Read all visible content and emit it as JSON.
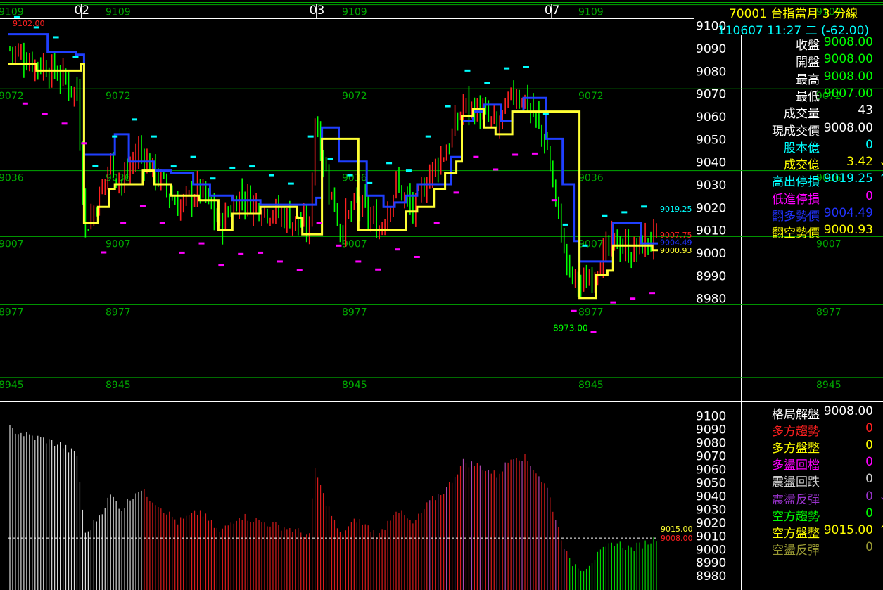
{
  "header": {
    "title": "70001  台指當月 3 分線",
    "subtitle": "110607 11:27 二   (-62.00)"
  },
  "quote_rows": [
    {
      "label": "收盤",
      "value": "9008.00",
      "label_color": "#ffffff",
      "value_color": "#00ff00",
      "arrow": ""
    },
    {
      "label": "開盤",
      "value": "9008.00",
      "label_color": "#ffffff",
      "value_color": "#00ff00",
      "arrow": ""
    },
    {
      "label": "最高",
      "value": "9008.00",
      "label_color": "#ffffff",
      "value_color": "#00ff00",
      "arrow": ""
    },
    {
      "label": "最低",
      "value": "9007.00",
      "label_color": "#ffffff",
      "value_color": "#00ff00",
      "arrow": ""
    },
    {
      "label": "成交量",
      "value": "43",
      "label_color": "#ffffff",
      "value_color": "#ffffff",
      "arrow": ""
    },
    {
      "label": "現成交價",
      "value": "9008.00",
      "label_color": "#ffffff",
      "value_color": "#ffffff",
      "arrow": ""
    },
    {
      "label": "股本億",
      "value": "0",
      "label_color": "#00ffff",
      "value_color": "#00ffff",
      "arrow": ""
    },
    {
      "label": "成交億",
      "value": "3.42",
      "label_color": "#ffff00",
      "value_color": "#ffff00",
      "arrow": "↓"
    },
    {
      "label": "高出停損",
      "value": "9019.25",
      "label_color": "#00ffff",
      "value_color": "#00ffff",
      "arrow": "↑"
    },
    {
      "label": "低進停損",
      "value": "0",
      "label_color": "#ff00ff",
      "value_color": "#ff00ff",
      "arrow": ""
    },
    {
      "label": "翻多勢價",
      "value": "9004.49",
      "label_color": "#2233ff",
      "value_color": "#2233ff",
      "arrow": ""
    },
    {
      "label": "翻空勢價",
      "value": "9000.93",
      "label_color": "#ffff00",
      "value_color": "#ffff00",
      "arrow": ""
    }
  ],
  "pattern_rows": [
    {
      "label": "格局解盤",
      "value": "9008.00",
      "label_color": "#ffffff",
      "value_color": "#ffffff",
      "arrow": ""
    },
    {
      "label": "多方趨勢",
      "value": "0",
      "label_color": "#ff2020",
      "value_color": "#ff2020",
      "arrow": ""
    },
    {
      "label": "多方盤整",
      "value": "0",
      "label_color": "#ffff00",
      "value_color": "#ffff00",
      "arrow": ""
    },
    {
      "label": "多盪回檔",
      "value": "0",
      "label_color": "#ff00ff",
      "value_color": "#ff00ff",
      "arrow": ""
    },
    {
      "label": "震盪回跌",
      "value": "0",
      "label_color": "#d0d0d0",
      "value_color": "#d0d0d0",
      "arrow": ""
    },
    {
      "label": "震盪反彈",
      "value": "0",
      "label_color": "#9933cc",
      "value_color": "#9933cc",
      "arrow": "↓"
    },
    {
      "label": "空方趨勢",
      "value": "0",
      "label_color": "#00ff00",
      "value_color": "#00ff00",
      "arrow": ""
    },
    {
      "label": "空方盤整",
      "value": "9015.00",
      "label_color": "#ffff00",
      "value_color": "#ffff00",
      "arrow": "↑"
    },
    {
      "label": "空盪反彈",
      "value": "0",
      "label_color": "#999933",
      "value_color": "#999933",
      "arrow": ""
    }
  ],
  "colors": {
    "up": "#ff2020",
    "down": "#00ff00",
    "grid": "#00aa00",
    "blue_line": "#1f3fff",
    "yellow_line": "#ffff33",
    "cyan_mark": "#00ffff",
    "magenta_mark": "#ff00ff"
  },
  "chart_data": [
    {
      "type": "candlestick",
      "x_tick_labels": [
        "02",
        "03",
        "07"
      ],
      "x_tick_bar_index": [
        26,
        110,
        194
      ],
      "bar_count": 232,
      "y_range": [
        8940,
        9103
      ],
      "y_tick_labels": [
        9100,
        9090,
        9080,
        9070,
        9060,
        9050,
        9040,
        9030,
        9020,
        9010,
        9000,
        8990,
        8980
      ],
      "level_lines": [
        9109,
        9072,
        9036,
        9007,
        8977,
        8945
      ],
      "annotations": [
        {
          "text": "9102.00",
          "value": 9102
        },
        {
          "text": "8973.00",
          "value": 8973
        },
        {
          "text": "9019.25",
          "value": 9019.25
        },
        {
          "text": "9007.75",
          "value": 9007.75
        },
        {
          "text": "9004.49",
          "value": 9004.49
        },
        {
          "text": "9000.93",
          "value": 9000.93
        }
      ],
      "close_path": [
        [
          0,
          9090
        ],
        [
          6,
          9085
        ],
        [
          12,
          9082
        ],
        [
          18,
          9078
        ],
        [
          24,
          9070
        ],
        [
          27,
          9010
        ],
        [
          32,
          9025
        ],
        [
          36,
          9040
        ],
        [
          40,
          9030
        ],
        [
          46,
          9045
        ],
        [
          52,
          9035
        ],
        [
          60,
          9020
        ],
        [
          68,
          9028
        ],
        [
          75,
          9012
        ],
        [
          82,
          9025
        ],
        [
          90,
          9020
        ],
        [
          100,
          9015
        ],
        [
          107,
          9010
        ],
        [
          109,
          9060
        ],
        [
          112,
          9040
        ],
        [
          118,
          9010
        ],
        [
          124,
          9022
        ],
        [
          132,
          9010
        ],
        [
          138,
          9030
        ],
        [
          144,
          9018
        ],
        [
          150,
          9035
        ],
        [
          156,
          9045
        ],
        [
          162,
          9065
        ],
        [
          168,
          9062
        ],
        [
          174,
          9055
        ],
        [
          180,
          9070
        ],
        [
          184,
          9068
        ],
        [
          188,
          9058
        ],
        [
          192,
          9045
        ],
        [
          196,
          9015
        ],
        [
          200,
          8990
        ],
        [
          205,
          8985
        ],
        [
          210,
          8995
        ],
        [
          216,
          9005
        ],
        [
          222,
          9000
        ],
        [
          228,
          9005
        ],
        [
          231,
          9008
        ]
      ],
      "blue_stop_path": [
        [
          0,
          9096
        ],
        [
          10,
          9096
        ],
        [
          14,
          9088
        ],
        [
          24,
          9087
        ],
        [
          27,
          9043
        ],
        [
          36,
          9043
        ],
        [
          38,
          9052
        ],
        [
          42,
          9052
        ],
        [
          43,
          9040
        ],
        [
          50,
          9040
        ],
        [
          52,
          9036
        ],
        [
          58,
          9035
        ],
        [
          66,
          9030
        ],
        [
          72,
          9025
        ],
        [
          80,
          9023
        ],
        [
          90,
          9021
        ],
        [
          105,
          9021
        ],
        [
          110,
          9024
        ],
        [
          112,
          9055
        ],
        [
          117,
          9055
        ],
        [
          118,
          9040
        ],
        [
          124,
          9040
        ],
        [
          128,
          9025
        ],
        [
          134,
          9020
        ],
        [
          138,
          9022
        ],
        [
          142,
          9025
        ],
        [
          146,
          9030
        ],
        [
          150,
          9030
        ],
        [
          154,
          9030
        ],
        [
          158,
          9042
        ],
        [
          162,
          9058
        ],
        [
          166,
          9062
        ],
        [
          170,
          9065
        ],
        [
          176,
          9058
        ],
        [
          180,
          9062
        ],
        [
          184,
          9068
        ],
        [
          188,
          9068
        ],
        [
          192,
          9050
        ],
        [
          198,
          9030
        ],
        [
          202,
          9005
        ],
        [
          204,
          8996
        ],
        [
          214,
          8996
        ],
        [
          216,
          9013
        ],
        [
          224,
          9013
        ],
        [
          226,
          9004
        ],
        [
          231,
          9004
        ]
      ],
      "yellow_stop_path": [
        [
          0,
          9083
        ],
        [
          10,
          9080
        ],
        [
          20,
          9080
        ],
        [
          26,
          9083
        ],
        [
          27,
          9013
        ],
        [
          32,
          9020
        ],
        [
          36,
          9028
        ],
        [
          38,
          9030
        ],
        [
          48,
          9036
        ],
        [
          52,
          9030
        ],
        [
          58,
          9025
        ],
        [
          68,
          9023
        ],
        [
          75,
          9010
        ],
        [
          80,
          9017
        ],
        [
          90,
          9020
        ],
        [
          103,
          9015
        ],
        [
          105,
          9008
        ],
        [
          110,
          9008
        ],
        [
          112,
          9050
        ],
        [
          124,
          9050
        ],
        [
          125,
          9010
        ],
        [
          142,
          9018
        ],
        [
          146,
          9020
        ],
        [
          150,
          9020
        ],
        [
          152,
          9028
        ],
        [
          156,
          9035
        ],
        [
          160,
          9040
        ],
        [
          162,
          9060
        ],
        [
          166,
          9063
        ],
        [
          170,
          9055
        ],
        [
          174,
          9052
        ],
        [
          180,
          9062
        ],
        [
          202,
          9062
        ],
        [
          204,
          8980
        ],
        [
          208,
          8980
        ],
        [
          210,
          8990
        ],
        [
          214,
          8992
        ],
        [
          216,
          9003
        ],
        [
          228,
          9003
        ],
        [
          230,
          9001
        ],
        [
          231,
          9001
        ]
      ]
    },
    {
      "type": "bar",
      "y_range": [
        8978,
        9103
      ],
      "y_tick_labels": [
        9100,
        9090,
        9080,
        9070,
        9060,
        9050,
        9040,
        9030,
        9020,
        9010,
        9000,
        8990,
        8980
      ],
      "annotations": [
        {
          "text": "9015.00",
          "value": 9015
        },
        {
          "text": "9008.00",
          "value": 9008
        }
      ],
      "reference_line": 9008
    }
  ]
}
